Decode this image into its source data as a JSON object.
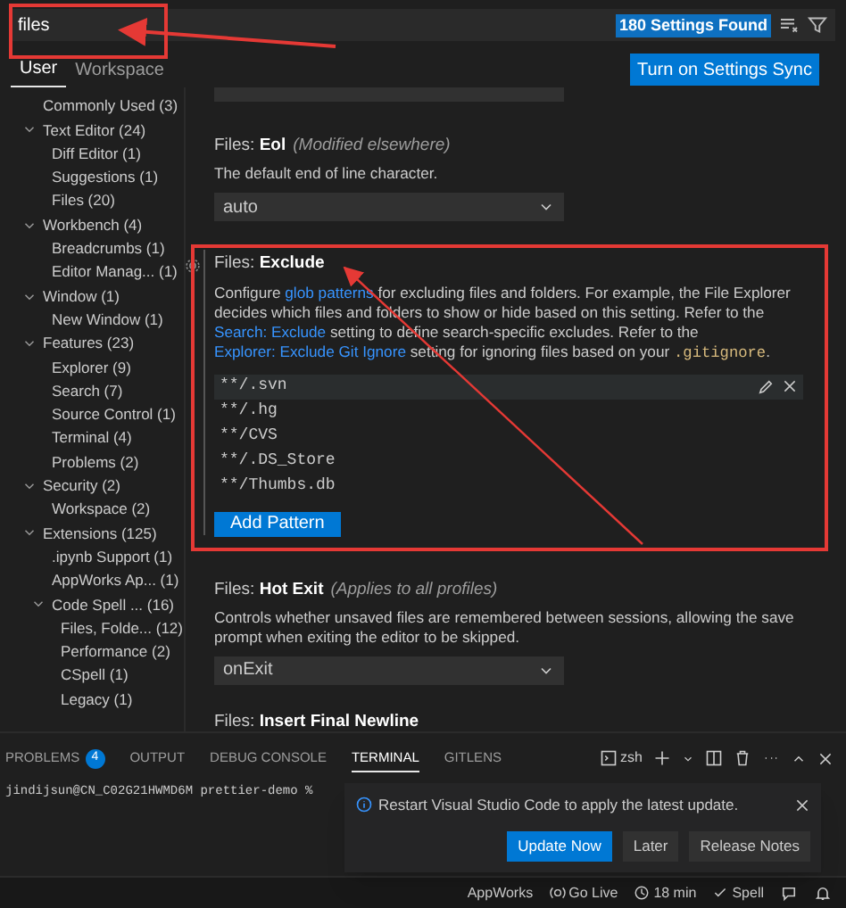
{
  "search": {
    "value": "files",
    "result_badge": "180 Settings Found"
  },
  "scope_tabs": [
    {
      "label": "User",
      "selected": true
    },
    {
      "label": "Workspace",
      "selected": false
    }
  ],
  "sync_button": "Turn on Settings Sync",
  "toc": [
    {
      "label": "Commonly Used",
      "count": "(3)"
    },
    {
      "label": "Text Editor",
      "count": "(24)",
      "expanded": true,
      "children": [
        {
          "label": "Diff Editor",
          "count": "(1)"
        },
        {
          "label": "Suggestions",
          "count": "(1)"
        },
        {
          "label": "Files",
          "count": "(20)"
        }
      ]
    },
    {
      "label": "Workbench",
      "count": "(4)",
      "expanded": true,
      "children": [
        {
          "label": "Breadcrumbs",
          "count": "(1)"
        },
        {
          "label": "Editor Manag...",
          "count": "(1)"
        }
      ]
    },
    {
      "label": "Window",
      "count": "(1)",
      "expanded": true,
      "children": [
        {
          "label": "New Window",
          "count": "(1)"
        }
      ]
    },
    {
      "label": "Features",
      "count": "(23)",
      "expanded": true,
      "children": [
        {
          "label": "Explorer",
          "count": "(9)"
        },
        {
          "label": "Search",
          "count": "(7)"
        },
        {
          "label": "Source Control",
          "count": "(1)"
        },
        {
          "label": "Terminal",
          "count": "(4)"
        },
        {
          "label": "Problems",
          "count": "(2)"
        }
      ]
    },
    {
      "label": "Security",
      "count": "(2)",
      "expanded": true,
      "children": [
        {
          "label": "Workspace",
          "count": "(2)"
        }
      ]
    },
    {
      "label": "Extensions",
      "count": "(125)",
      "expanded": true,
      "children": [
        {
          "label": ".ipynb Support",
          "count": "(1)"
        },
        {
          "label": "AppWorks Ap...",
          "count": "(1)"
        },
        {
          "label": "Code Spell ...",
          "count": "(16)",
          "expanded": true,
          "children": [
            {
              "label": "Files, Folde...",
              "count": "(12)"
            },
            {
              "label": "Performance",
              "count": "(2)"
            },
            {
              "label": "CSpell",
              "count": "(1)"
            },
            {
              "label": "Legacy",
              "count": "(1)"
            }
          ]
        }
      ]
    }
  ],
  "settings": [
    {
      "kind": "dropdown",
      "title": "Files: **Eol**",
      "note": "(Modified elsewhere)",
      "description": [
        {
          "kind": "text",
          "text": "The default end of line character."
        }
      ],
      "value": "auto"
    },
    {
      "kind": "list",
      "focused": true,
      "title": "Files: **Exclude**",
      "description": [
        {
          "kind": "text",
          "text": "Configure "
        },
        {
          "kind": "link",
          "text": "glob patterns"
        },
        {
          "kind": "text",
          "text": " for excluding files and folders. For example, the File Explorer decides which files and folders to show or hide based on this setting. Refer to the "
        },
        {
          "kind": "link",
          "text": "Search: Exclude"
        },
        {
          "kind": "text",
          "text": " setting to define search-specific excludes. Refer to the "
        },
        {
          "kind": "link",
          "text": "Explorer: Exclude Git Ignore"
        },
        {
          "kind": "text",
          "text": " setting for ignoring files based on your "
        },
        {
          "kind": "code",
          "text": ".gitignore"
        },
        {
          "kind": "text",
          "text": "."
        }
      ],
      "items": [
        {
          "text": "**/.svn",
          "selected": true
        },
        {
          "text": "**/.hg",
          "selected": false
        },
        {
          "text": "**/CVS",
          "selected": false
        },
        {
          "text": "**/.DS_Store",
          "selected": false
        },
        {
          "text": "**/Thumbs.db",
          "selected": false
        }
      ],
      "add_button": "Add Pattern"
    },
    {
      "kind": "dropdown",
      "title": "Files: **Hot Exit**",
      "note": "(Applies to all profiles)",
      "description": [
        {
          "kind": "text",
          "text": "Controls whether unsaved files are remembered between sessions, allowing the save prompt when exiting the editor to be skipped."
        }
      ],
      "value": "onExit"
    },
    {
      "kind": "cut",
      "title": "Files: **Insert Final Newline**"
    }
  ],
  "panel": {
    "tabs": [
      {
        "label": "PROBLEMS",
        "badge": "4",
        "selected": false
      },
      {
        "label": "OUTPUT",
        "selected": false
      },
      {
        "label": "DEBUG CONSOLE",
        "selected": false
      },
      {
        "label": "TERMINAL",
        "selected": true
      },
      {
        "label": "GITLENS",
        "selected": false
      }
    ],
    "shell": "zsh",
    "terminal_line": "jindijsun@CN_C02G21HWMD6M prettier-demo %"
  },
  "notification": {
    "message": "Restart Visual Studio Code to apply the latest update.",
    "buttons": [
      {
        "label": "Update Now",
        "kind": "primary"
      },
      {
        "label": "Later",
        "kind": "secondary"
      },
      {
        "label": "Release Notes",
        "kind": "secondary"
      }
    ]
  },
  "status_bar": [
    {
      "kind": "plain",
      "text": "AppWorks"
    },
    {
      "kind": "live",
      "text": "Go Live"
    },
    {
      "kind": "clock",
      "text": "18 min"
    },
    {
      "kind": "check",
      "text": "Spell"
    }
  ]
}
